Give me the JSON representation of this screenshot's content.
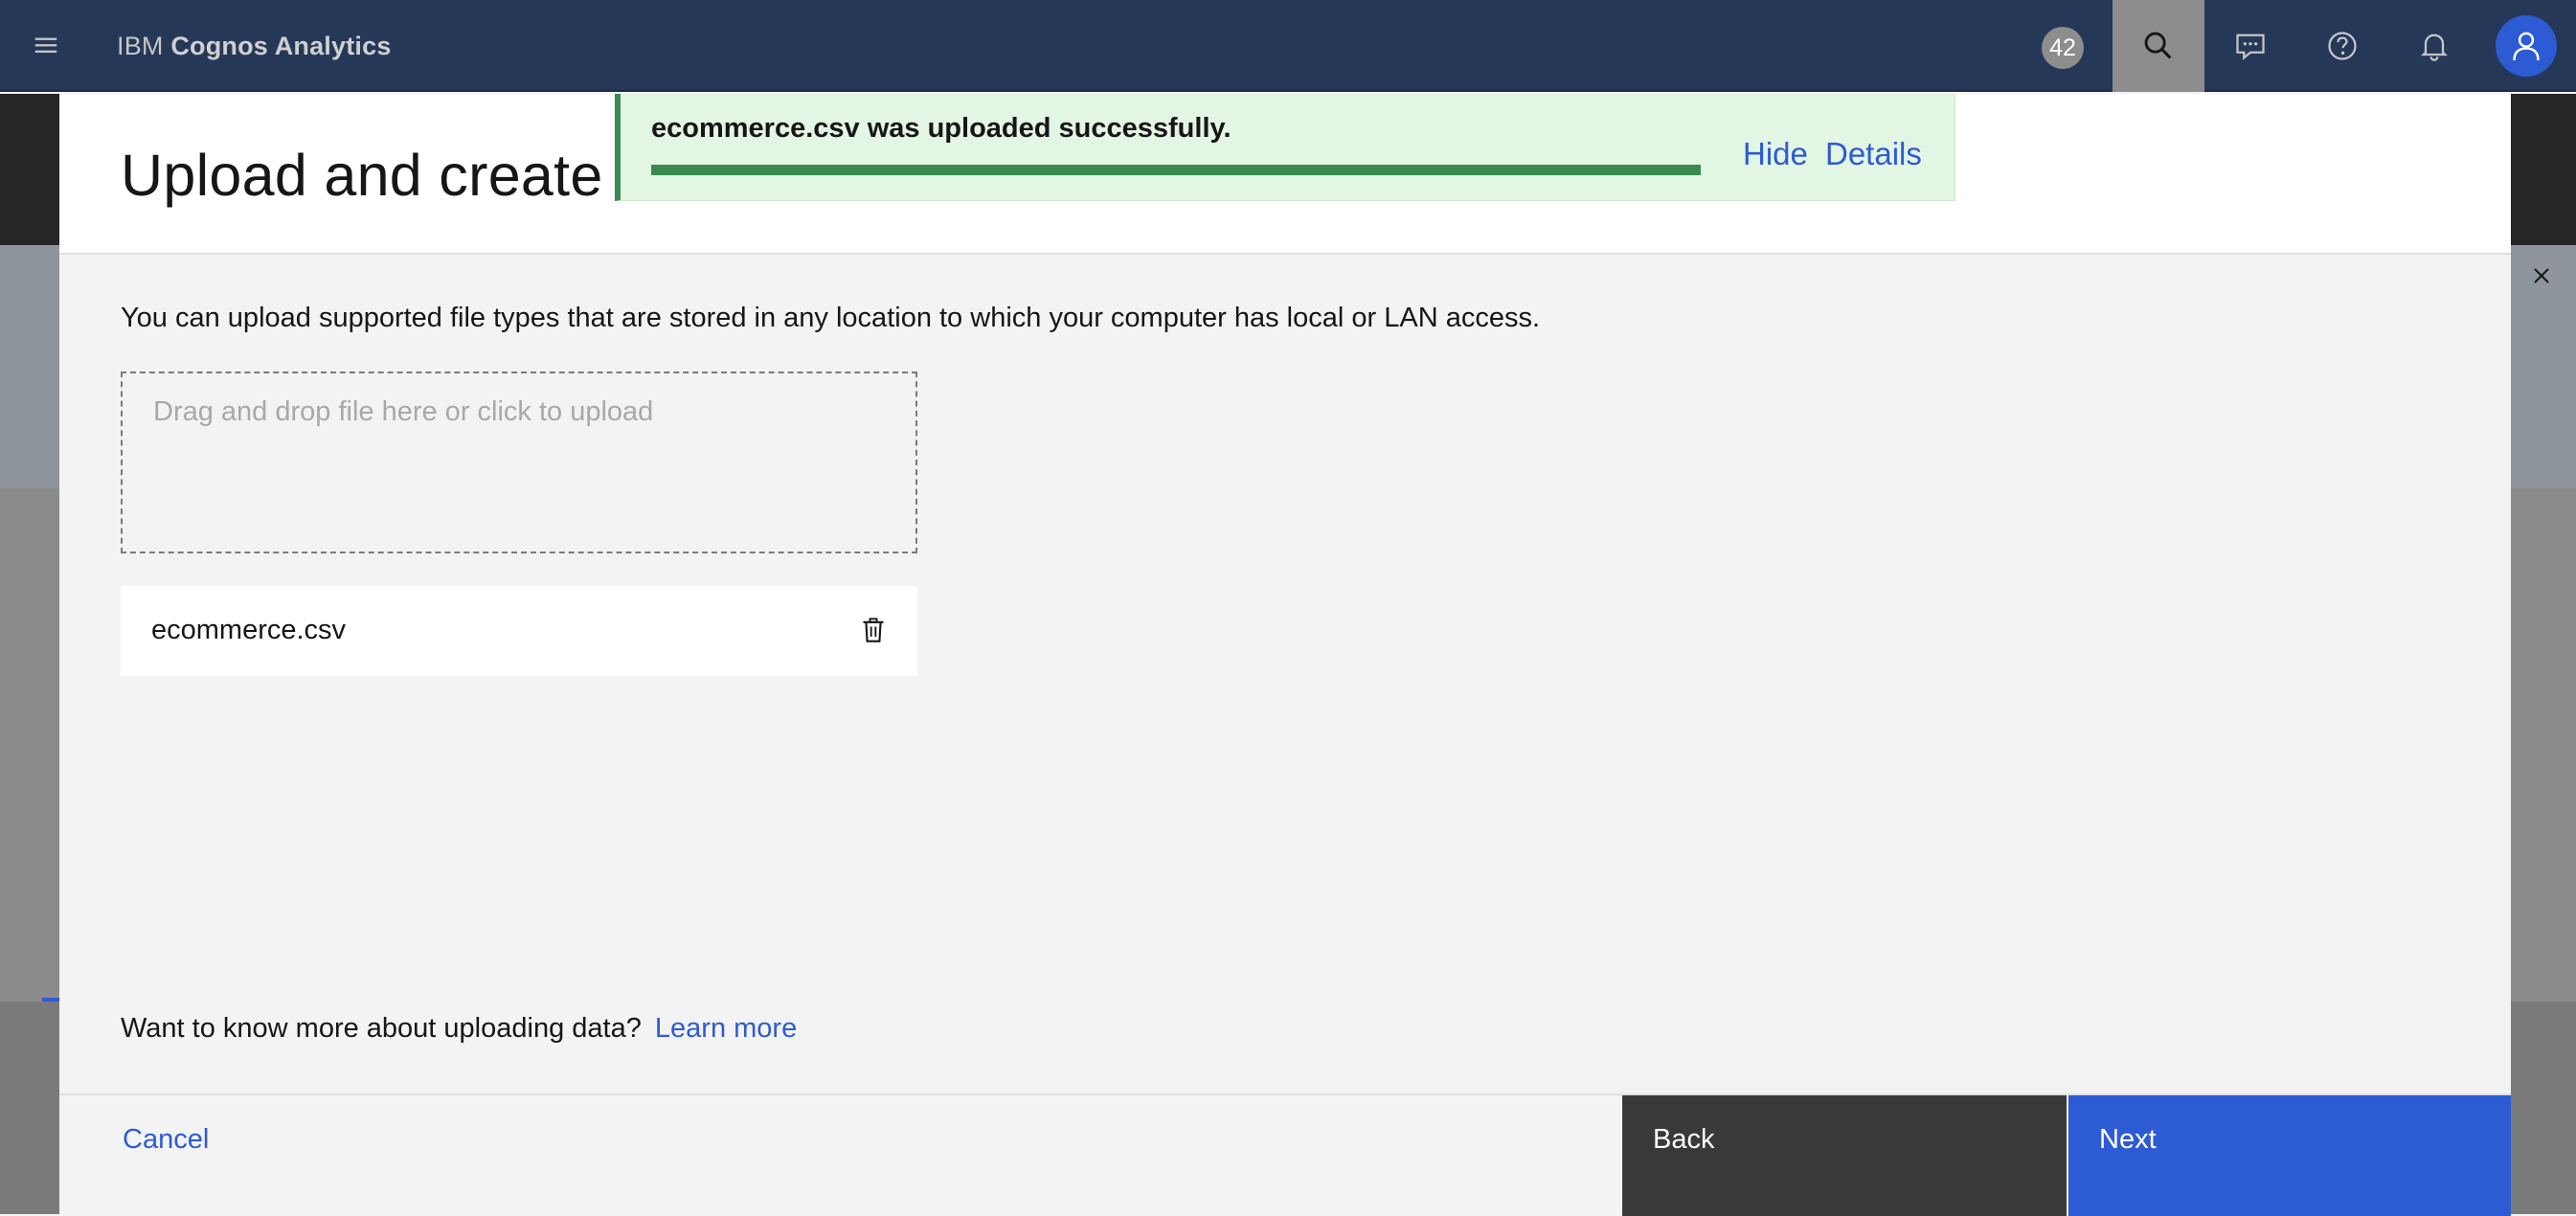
{
  "app": {
    "brand_prefix": "IBM",
    "brand_name": "Cognos Analytics",
    "notification_count": "42",
    "icons": [
      "menu-icon",
      "search-icon",
      "chat-icon",
      "help-icon",
      "notification-icon",
      "user-icon"
    ]
  },
  "toast": {
    "message": "ecommerce.csv was uploaded successfully.",
    "progress": 1.0,
    "hide_label": "Hide",
    "details_label": "Details",
    "color": "#398a4f"
  },
  "modal": {
    "title": "Upload and create",
    "description": "You can upload supported file types that are stored in any location to which your computer has local or LAN access.",
    "dropzone_text": "Drag and drop file here or click to upload",
    "files": [
      {
        "name": "ecommerce.csv"
      }
    ],
    "learn_more_prompt": "Want to know more about uploading data?",
    "learn_more_link": "Learn more",
    "cancel_label": "Cancel",
    "back_label": "Back",
    "next_label": "Next"
  },
  "colors": {
    "accent": "#2d5bd3",
    "topbar": "#253858",
    "success": "#398a4f"
  }
}
